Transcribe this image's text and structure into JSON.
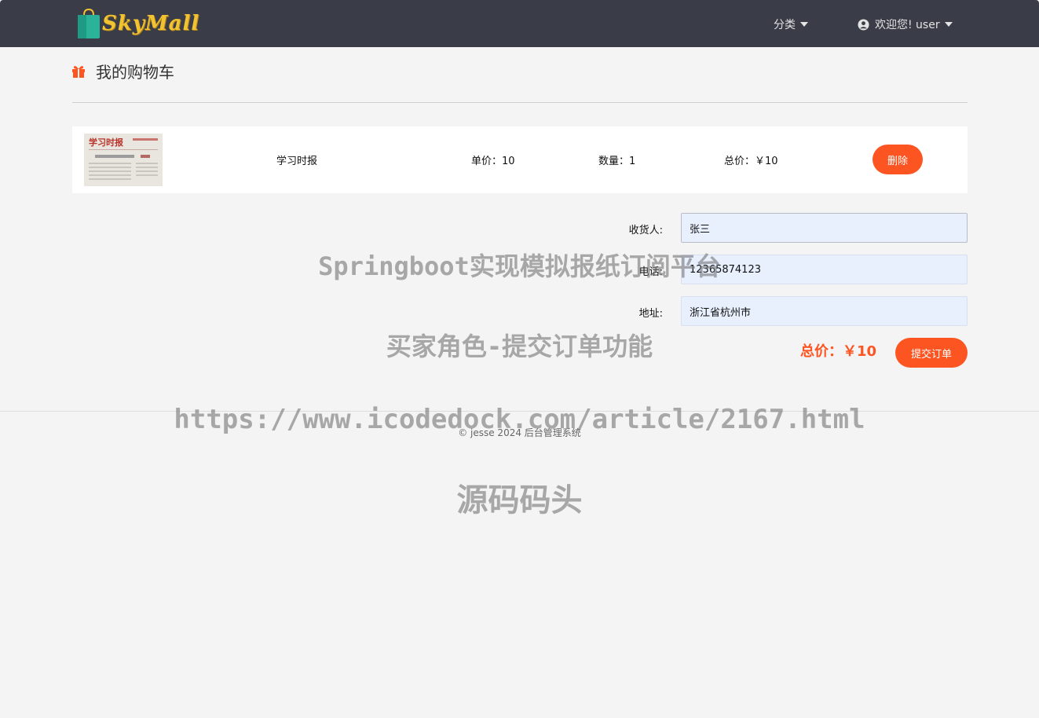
{
  "navbar": {
    "logo_text": "SkyMall",
    "category_label": "分类",
    "user_label": "欢迎您! user"
  },
  "page": {
    "title": "我的购物车"
  },
  "cart_item": {
    "name": "学习时报",
    "unit_price": "单价：10",
    "quantity": "数量：1",
    "subtotal": "总价：￥10",
    "delete_label": "删除",
    "thumbnail_text": "学习时报"
  },
  "form": {
    "receiver_label": "收货人:",
    "receiver_value": "张三",
    "phone_label": "电话:",
    "phone_value": "12365874123",
    "address_label": "地址:",
    "address_value": "浙江省杭州市"
  },
  "order": {
    "total": "总价：￥10",
    "submit_label": "提交订单"
  },
  "footer": {
    "text": "© jesse 2024  后台管理系统"
  },
  "watermarks": {
    "line1": "Springboot实现模拟报纸订阅平台",
    "line2": "买家角色-提交订单功能",
    "line3": "https://www.icodedock.com/article/2167.html",
    "line4": "源码码头"
  },
  "colors": {
    "accent": "#fc5522",
    "navbar": "#3a3d47",
    "input_bg": "#e8f0fe"
  },
  "icons": {
    "logo": "shopping-bag-icon",
    "user": "user-circle-icon",
    "gift": "gift-icon"
  }
}
